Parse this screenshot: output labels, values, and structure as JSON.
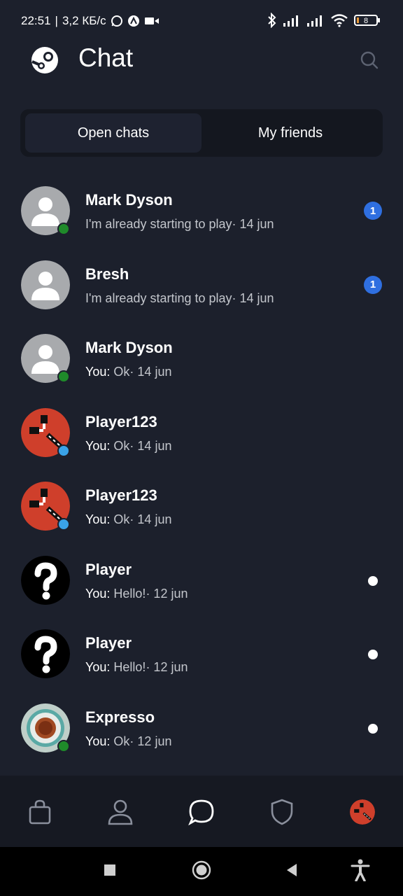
{
  "status_bar": {
    "time": "22:51",
    "separator": "|",
    "speed": "3,2 КБ/с",
    "battery_level": "8",
    "icons": [
      "whatsapp-icon",
      "app-icon",
      "video-icon",
      "bluetooth-icon",
      "signal-icon",
      "signal-icon",
      "wifi-icon",
      "battery-icon"
    ]
  },
  "header": {
    "title": "Chat",
    "search_icon": "search-icon",
    "logo_icon": "steam-logo"
  },
  "tabs": [
    {
      "label": "Open chats",
      "active": true
    },
    {
      "label": "My friends",
      "active": false
    }
  ],
  "chats": [
    {
      "name": "Mark Dyson",
      "you": "",
      "message": "I'm already starting to play",
      "date": "· 14 jun",
      "avatar": "default",
      "presence": "online",
      "unread": "1"
    },
    {
      "name": "Bresh",
      "you": "",
      "message": "I'm already starting to play",
      "date": "· 14 jun",
      "avatar": "default",
      "presence": "",
      "unread": "1"
    },
    {
      "name": "Mark Dyson",
      "you": "You:",
      "message": "Ok",
      "date": "· 14 jun",
      "avatar": "default",
      "presence": "online",
      "unread": ""
    },
    {
      "name": "Player123",
      "you": "You:",
      "message": "Ok",
      "date": "· 14 jun",
      "avatar": "rust",
      "presence": "in-game",
      "unread": ""
    },
    {
      "name": "Player123",
      "you": "You:",
      "message": "Ok",
      "date": "· 14 jun",
      "avatar": "rust",
      "presence": "in-game",
      "unread": ""
    },
    {
      "name": "Player",
      "you": "You:",
      "message": "Hello!",
      "date": "· 12 jun",
      "avatar": "question",
      "presence": "",
      "unread": "dot"
    },
    {
      "name": "Player",
      "you": "You:",
      "message": "Hello!",
      "date": "· 12 jun",
      "avatar": "question",
      "presence": "",
      "unread": "dot"
    },
    {
      "name": "Expresso",
      "you": "You:",
      "message": "Ok",
      "date": "· 12 jun",
      "avatar": "coffee",
      "presence": "online",
      "unread": "dot"
    }
  ],
  "bottom_nav": [
    "store-icon",
    "profile-icon",
    "chat-icon",
    "shield-icon",
    "user-avatar"
  ],
  "system_nav": [
    "recents-icon",
    "home-icon",
    "back-icon",
    "accessibility-icon"
  ],
  "colors": {
    "background": "#1c202c",
    "online": "#1f8a2a",
    "in_game": "#3aa3e8",
    "badge": "#2f6fe0",
    "rust_red": "#cf3f2b"
  }
}
